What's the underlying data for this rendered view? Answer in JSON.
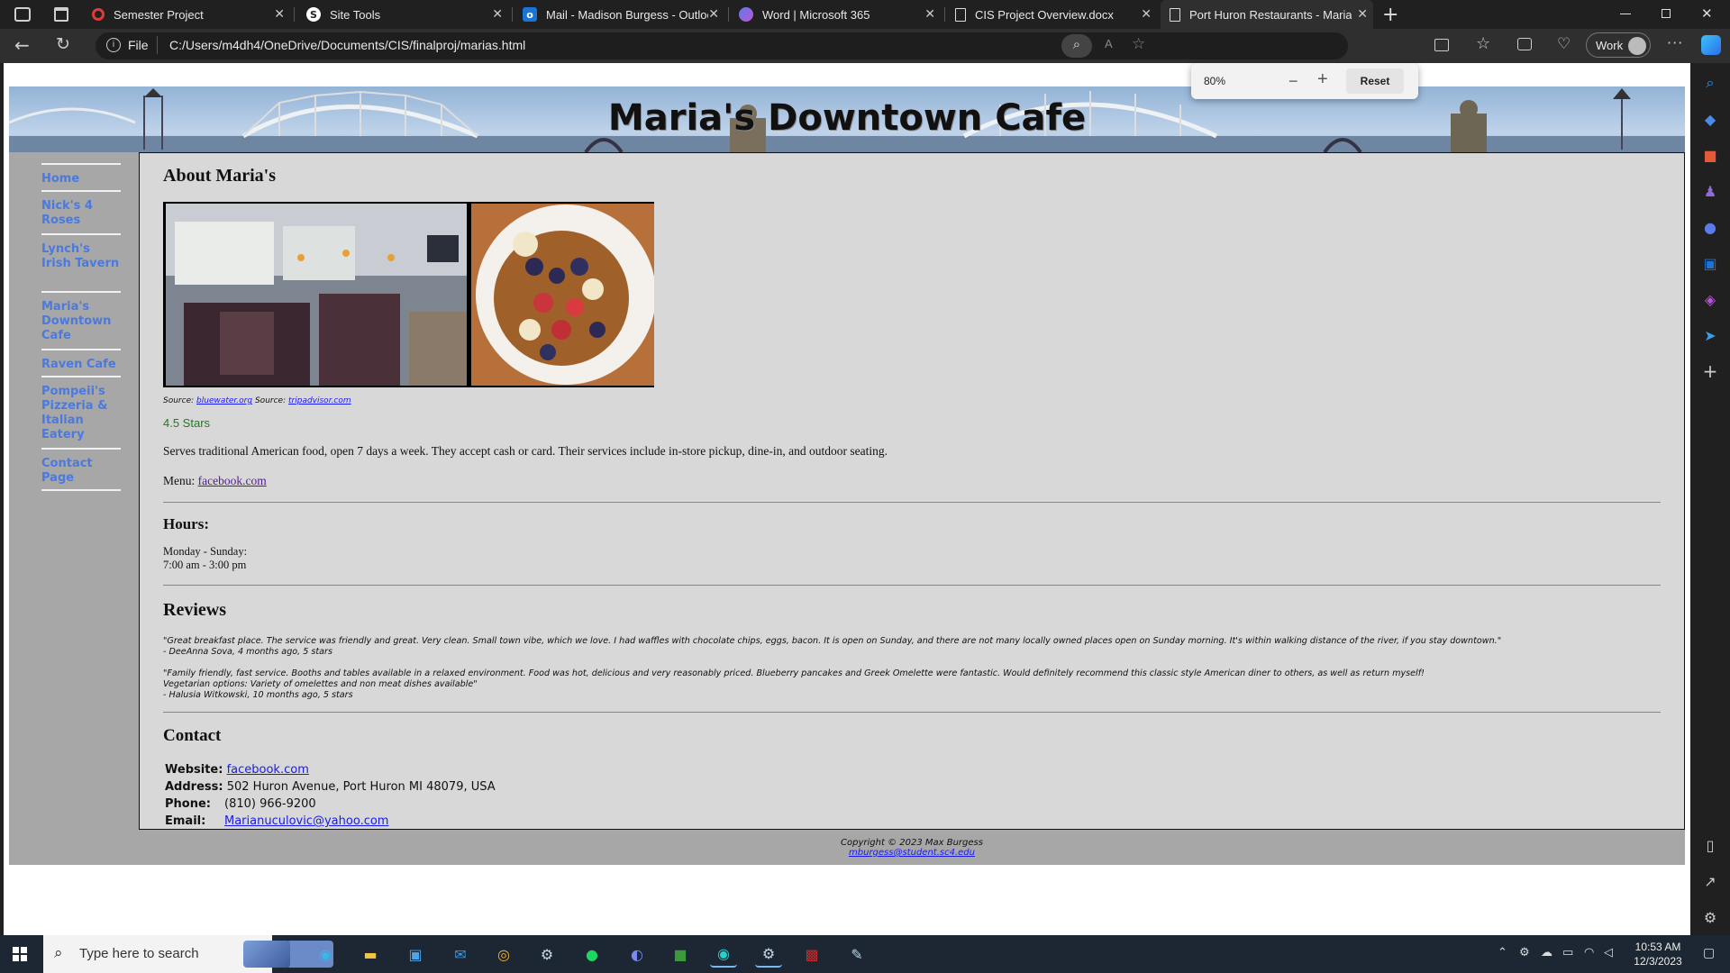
{
  "browser": {
    "tabs": [
      {
        "label": "Semester Project",
        "icon": "semester-icon"
      },
      {
        "label": "Site Tools",
        "icon": "site-tools-icon"
      },
      {
        "label": "Mail - Madison Burgess - Outloo",
        "icon": "outlook-icon"
      },
      {
        "label": "Word | Microsoft 365",
        "icon": "m365-icon"
      },
      {
        "label": "CIS Project Overview.docx",
        "icon": "document-icon"
      },
      {
        "label": "Port Huron Restaurants - Maria's",
        "icon": "document-icon"
      }
    ],
    "address_prefix": "File",
    "address": "C:/Users/m4dh4/OneDrive/Documents/CIS/finalproj/marias.html",
    "profile_label": "Work",
    "zoom": {
      "value": "80%",
      "reset_label": "Reset"
    }
  },
  "page": {
    "banner_title": "Maria's Downtown Cafe",
    "nav": [
      "Home",
      "Nick's 4 Roses",
      "Lynch's Irish Tavern",
      "Maria's Downtown Cafe",
      "Raven Cafe",
      "Pompeii's Pizzeria & Italian Eatery",
      "Contact Page"
    ],
    "about_heading": "About Maria's",
    "source1_prefix": "Source:",
    "source1_link": "bluewater.org",
    "source2_prefix": "Source:",
    "source2_link": "tripadvisor.com",
    "rating": "4.5 Stars",
    "description": "Serves traditional American food, open 7 days a week. They accept cash or card. Their services include in-store pickup, dine-in, and outdoor seating.",
    "menu_label": "Menu:",
    "menu_link": "facebook.com",
    "hours_heading": "Hours:",
    "hours_days": "Monday - Sunday:",
    "hours_time": "7:00 am - 3:00 pm",
    "reviews_heading": "Reviews",
    "reviews": [
      {
        "lines": [
          "\"Great breakfast place. The service was friendly and great. Very clean. Small town vibe, which we love. I had waffles with chocolate chips, eggs, bacon. It is open on Sunday, and there are not many locally owned places open on Sunday morning. It's within walking distance of the river, if you stay downtown.\""
        ],
        "author": "- DeeAnna Sova, 4 months ago, 5 stars"
      },
      {
        "lines": [
          "\"Family friendly, fast service. Booths and tables available in a relaxed environment. Food was hot, delicious and very reasonably priced. Blueberry pancakes and Greek Omelette were fantastic. Would definitely recommend this classic style American diner to others, as well as return myself!",
          "Vegetarian options: Variety of omelettes and non meat dishes available\""
        ],
        "author": "- Halusia Witkowski, 10 months ago, 5 stars"
      }
    ],
    "contact_heading": "Contact",
    "contact": {
      "website_label": "Website:",
      "website": "facebook.com",
      "address_label": "Address:",
      "address": "502 Huron Avenue, Port Huron MI 48079, USA",
      "phone_label": "Phone:",
      "phone": "(810) 966-9200",
      "email_label": "Email:",
      "email": "Marianuculovic@yahoo.com"
    },
    "footer_copyright": "Copyright © 2023 Max Burgess",
    "footer_email": "mburgess@student.sc4.edu"
  },
  "taskbar": {
    "search_placeholder": "Type here to search",
    "time": "10:53 AM",
    "date": "12/3/2023"
  },
  "colors": {
    "page_bg": "#a7a7a7",
    "content_bg": "#d8d8d8",
    "nav_link": "#4a79e0",
    "rating_green": "#1f7a1f",
    "edge_accent": "#3a9ae8"
  }
}
